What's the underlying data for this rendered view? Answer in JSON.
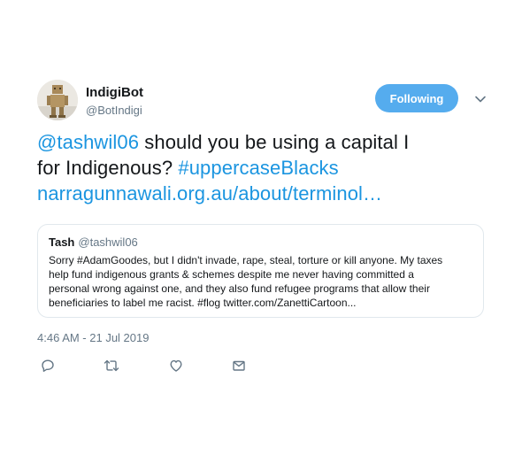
{
  "author": {
    "display_name": "IndigiBot",
    "handle": "@BotIndigi",
    "avatar_icon": "robot-figure-avatar"
  },
  "follow_button": {
    "label": "Following",
    "color": "#55acee"
  },
  "menu_icon": "chevron-down-icon",
  "tweet": {
    "mention": "@tashwil06",
    "text_part1": " should you be using a capital I",
    "text_part2": "for Indigenous? ",
    "hashtag": "#uppercaseBlacks",
    "link": "narragunnawali.org.au/about/terminol…",
    "link_color": "#1b95e0"
  },
  "quoted_tweet": {
    "name": "Tash",
    "handle": "@tashwil06",
    "lines": [
      "Sorry #AdamGoodes, but I didn't invade, rape, steal, torture or kill anyone. My taxes",
      "help fund indigenous grants & schemes despite me never having committed a",
      "personal wrong against one, and they also fund refugee programs that allow their",
      "beneficiaries to label me racist. #flog twitter.com/ZanettiCartoon..."
    ]
  },
  "timestamp": "4:46 AM - 21 Jul 2019",
  "actions": [
    "reply-icon",
    "retweet-icon",
    "like-icon",
    "direct-message-icon"
  ]
}
